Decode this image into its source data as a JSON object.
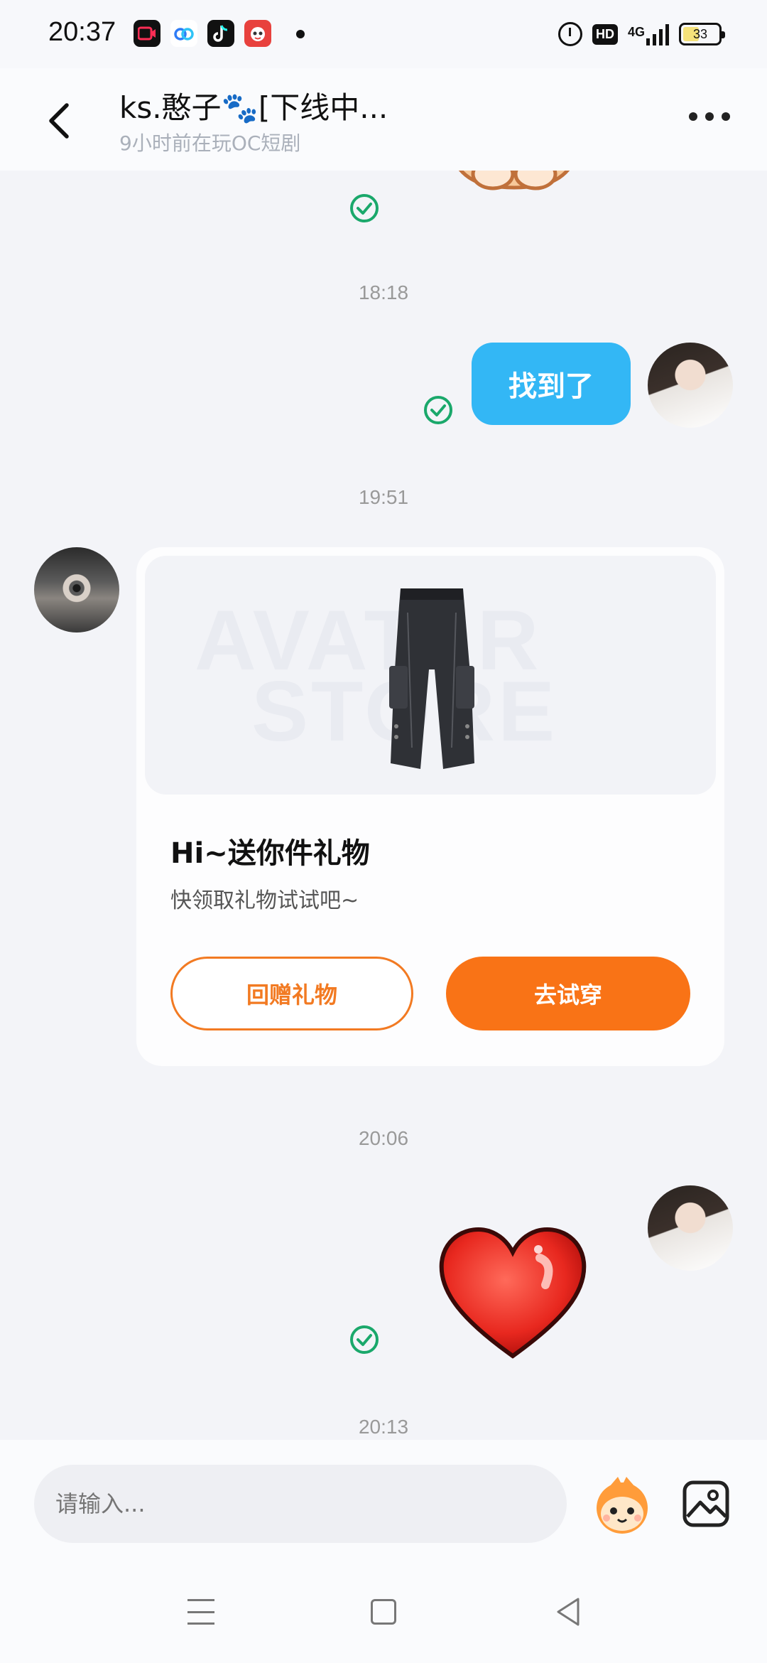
{
  "status_bar": {
    "time": "20:37",
    "apps": [
      "video-app-icon",
      "baidu-netdisk-icon",
      "douyin-icon",
      "game-app-icon"
    ],
    "hd": "HD",
    "network": "4G",
    "battery": "33"
  },
  "header": {
    "title": "ks.憨子🐾[下线中...",
    "subtitle": "9小时前在玩OC短剧"
  },
  "chat": {
    "time_1": "18:18",
    "message_me_1": "找到了",
    "time_2": "19:51",
    "gift_card": {
      "watermark_line1": "AVATAR",
      "watermark_line2": "STORE",
      "title": "Hi~送你件礼物",
      "description": "快领取礼物试试吧~",
      "return_gift_label": "回赠礼物",
      "try_on_label": "去试穿"
    },
    "time_3": "20:06",
    "time_4": "20:13"
  },
  "input": {
    "placeholder": "请输入..."
  },
  "colors": {
    "bubble_me": "#33b7f5",
    "accent_orange": "#f97316",
    "read_check": "#1aa86b",
    "background": "#f3f4f8"
  }
}
